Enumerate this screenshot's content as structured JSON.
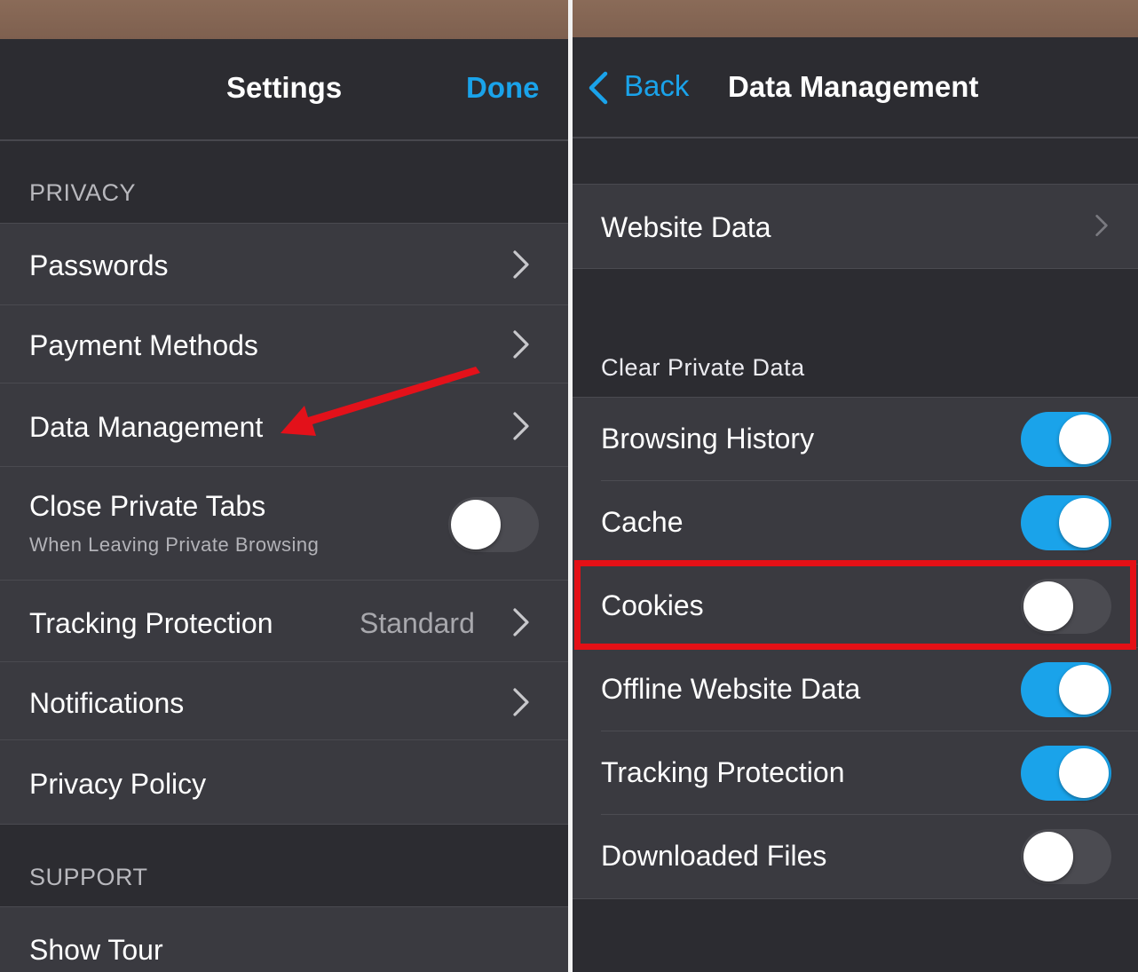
{
  "colors": {
    "accent": "#1aa3ea",
    "highlight": "#e41016",
    "arrow": "#e3111a"
  },
  "settings": {
    "title": "Settings",
    "done_label": "Done",
    "privacy_header": "PRIVACY",
    "items": [
      {
        "label": "Passwords",
        "icon": "chevron-right-icon"
      },
      {
        "label": "Payment Methods",
        "icon": "chevron-right-icon"
      },
      {
        "label": "Data Management",
        "icon": "chevron-right-icon"
      },
      {
        "label": "Close Private Tabs",
        "subtitle": "When Leaving Private Browsing",
        "toggle": false
      },
      {
        "label": "Tracking Protection",
        "value": "Standard",
        "icon": "chevron-right-icon"
      },
      {
        "label": "Notifications",
        "icon": "chevron-right-icon"
      },
      {
        "label": "Privacy Policy"
      }
    ],
    "support_header": "SUPPORT",
    "support_items": [
      {
        "label": "Show Tour"
      }
    ]
  },
  "data_management": {
    "back_label": "Back",
    "title": "Data Management",
    "website_data_label": "Website Data",
    "clear_header": "Clear Private Data",
    "items": [
      {
        "label": "Browsing History",
        "on": true
      },
      {
        "label": "Cache",
        "on": true
      },
      {
        "label": "Cookies",
        "on": false
      },
      {
        "label": "Offline Website Data",
        "on": true
      },
      {
        "label": "Tracking Protection",
        "on": true
      },
      {
        "label": "Downloaded Files",
        "on": false
      }
    ]
  }
}
